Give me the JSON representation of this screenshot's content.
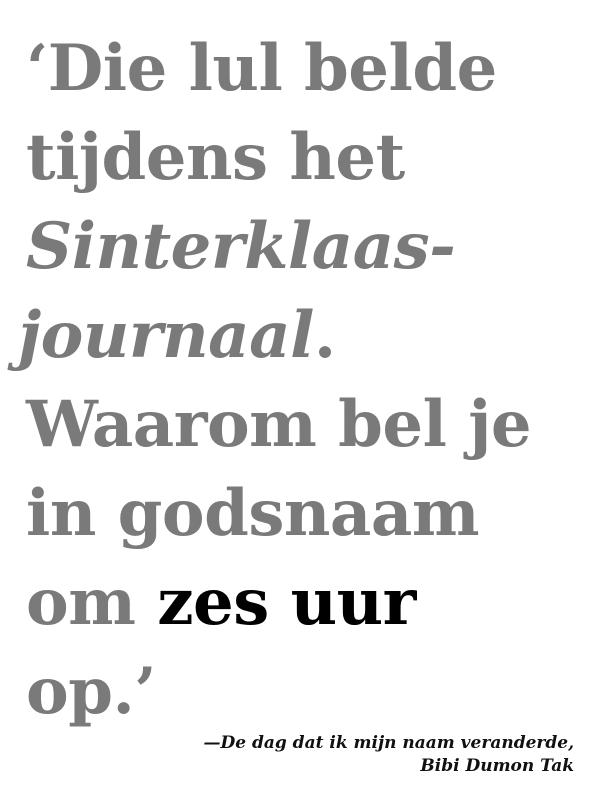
{
  "quote": {
    "line1": "‘Die lul belde",
    "line2": "tijdens het",
    "line3": "Sinterklaas-",
    "line4_italic": "journaal",
    "line4_end": ".",
    "line5": "Waarom bel je",
    "line6": "in godsnaam",
    "line7_start": "om ",
    "line7_emphasis": "zes uur",
    "line8": "op.’"
  },
  "attribution": {
    "line1": "—De dag dat ik mijn naam veranderde,",
    "line2": "Bibi Dumon Tak"
  },
  "colors": {
    "quote_text": "#7a7a7a",
    "emphasis_text": "#000000",
    "attribution_text": "#111111",
    "background": "#ffffff"
  }
}
